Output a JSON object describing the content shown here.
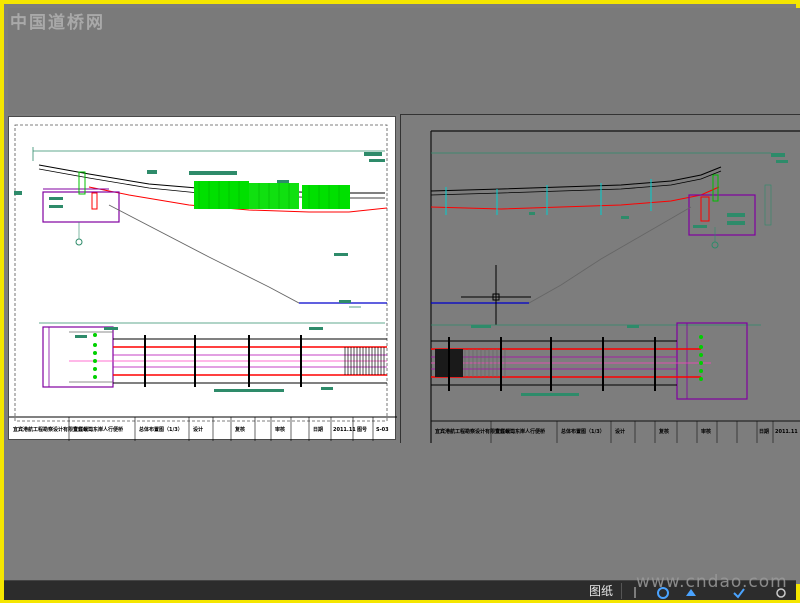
{
  "watermark_top": "中国道桥网",
  "watermark_bottom": "www.cndao.com",
  "colors": {
    "frame": "#f5e600",
    "workspace": "#7d7d7d",
    "sheet": "#ffffff",
    "deck_line": "#ff0000",
    "green_fill": "#00e000",
    "abutment": "#8000a0",
    "water_line": "#0000cc",
    "annotation": "#2e8b6a"
  },
  "title_block_left": {
    "company": "宜宾港航工程勘察设计有限责任公司",
    "project": "宜宾岷江东岸人行便桥",
    "drawing": "总体布置图（1/3）",
    "cells": [
      "设计",
      "复核",
      "审核",
      "日期",
      "2011.11",
      "图号",
      "S-03"
    ]
  },
  "title_block_right": {
    "company": "宜宾港航工程勘察设计有限责任公司",
    "project": "宜宾岷江东岸人行便桥",
    "drawing": "总体布置图（1/3）",
    "cells": [
      "设计",
      "复核",
      "审核",
      "日期",
      "2011.11"
    ]
  },
  "status_bar": {
    "layout_tab": "图纸",
    "icons": [
      "nav-icon",
      "annotation-scale-icon",
      "workspace-icon",
      "lock-icon",
      "settings-icon"
    ]
  }
}
